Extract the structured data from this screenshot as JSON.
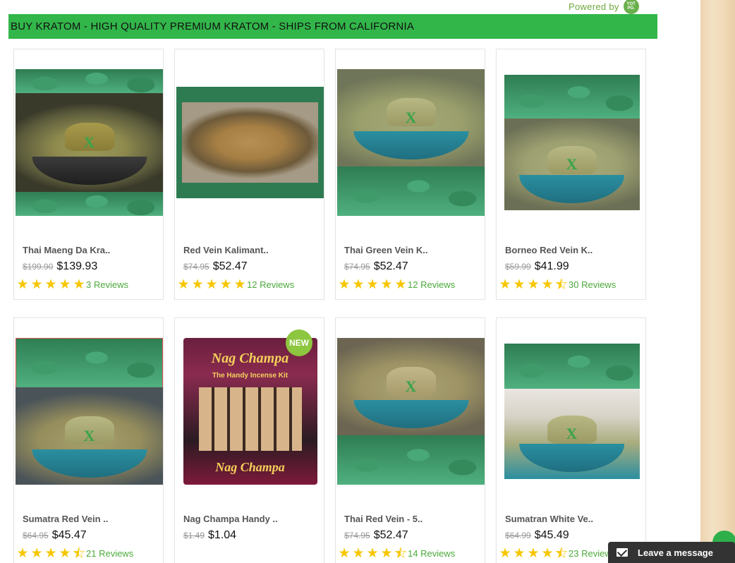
{
  "header": {
    "powered_by": "Powered by",
    "yotpo_label": "YOT PO."
  },
  "banner": {
    "title": "BUY KRATOM - HIGH QUALITY PREMIUM KRATOM - SHIPS FROM CALIFORNIA"
  },
  "products": [
    {
      "title": "Thai Maeng Da Kra..",
      "old_price": "$199.90",
      "price": "$139.93",
      "rating": 5,
      "reviews": "3 Reviews"
    },
    {
      "title": "Red Vein Kalimant..",
      "old_price": "$74.95",
      "price": "$52.47",
      "rating": 5,
      "reviews": "12 Reviews"
    },
    {
      "title": "Thai Green Vein K..",
      "old_price": "$74.95",
      "price": "$52.47",
      "rating": 5,
      "reviews": "12 Reviews"
    },
    {
      "title": "Borneo Red Vein K..",
      "old_price": "$59.99",
      "price": "$41.99",
      "rating": 4.5,
      "reviews": "30 Reviews"
    },
    {
      "title": "Sumatra Red Vein ..",
      "old_price": "$64.95",
      "price": "$45.47",
      "rating": 4.5,
      "reviews": "21 Reviews"
    },
    {
      "title": "Nag Champa Handy ..",
      "old_price": "$1.49",
      "price": "$1.04",
      "badge": "NEW",
      "incense_title": "Nag Champa",
      "incense_sub": "The Handy Incense Kit"
    },
    {
      "title": "Thai Red Vein - 5..",
      "old_price": "$74.95",
      "price": "$52.47",
      "rating": 4.5,
      "reviews": "14 Reviews"
    },
    {
      "title": "Sumatran White Ve..",
      "old_price": "$64.99",
      "price": "$45.49",
      "rating": 4.5,
      "reviews": "23 Reviews"
    }
  ],
  "chat": {
    "label": "Leave a message"
  },
  "colors": {
    "banner_bg": "#32b64a",
    "star": "#f6c700",
    "reviews_link": "#4caa3b",
    "chat_bg": "#333333"
  }
}
